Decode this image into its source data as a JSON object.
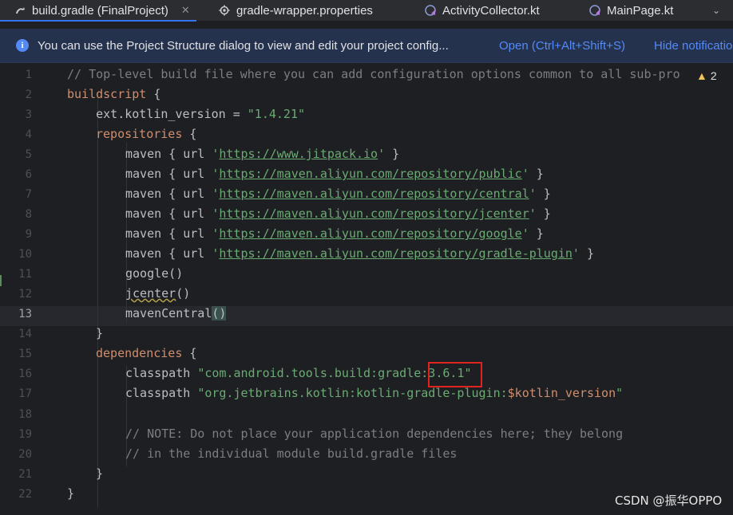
{
  "tabs": [
    {
      "label": "build.gradle (FinalProject)",
      "icon": "gradle-icon",
      "close": "✕",
      "active": true
    },
    {
      "label": "gradle-wrapper.properties",
      "icon": "gear-icon"
    },
    {
      "label": "ActivityCollector.kt",
      "icon": "kotlin-class-icon"
    },
    {
      "label": "MainPage.kt",
      "icon": "kotlin-class-icon"
    }
  ],
  "tab_more": "⌄",
  "banner": {
    "icon": "i",
    "message": "You can use the Project Structure dialog to view and edit your project config...",
    "open_link": "Open (Ctrl+Alt+Shift+S)",
    "hide_link": "Hide notification"
  },
  "editor": {
    "warning_icon": "▲",
    "warning_count": "2",
    "current_line": 13,
    "line_numbers": [
      "1",
      "2",
      "3",
      "4",
      "5",
      "6",
      "7",
      "8",
      "9",
      "10",
      "11",
      "12",
      "13",
      "14",
      "15",
      "16",
      "17",
      "18",
      "19",
      "20",
      "21",
      "22"
    ],
    "code": {
      "l1": "// Top-level build file where you can add configuration options common to all sub-pro",
      "l2_kw": "buildscript",
      "l2_rest": " {",
      "l3_a": "    ext.kotlin_version = ",
      "l3_str": "\"1.4.21\"",
      "l4_kw": "repositories",
      "l4_rest": " {",
      "maven_prefix": "maven { url ",
      "q": "'",
      "maven_suffix": " }",
      "urls": [
        "https://www.jitpack.io",
        "https://maven.aliyun.com/repository/public",
        "https://maven.aliyun.com/repository/central",
        "https://maven.aliyun.com/repository/jcenter",
        "https://maven.aliyun.com/repository/google",
        "https://maven.aliyun.com/repository/gradle-plugin"
      ],
      "l11": "google()",
      "l12": "jcenter",
      "l12_parens": "()",
      "l13_a": "mavenCentral",
      "l13_b": "(",
      "l13_c": ")",
      "l14": "}",
      "l15_kw": "dependencies",
      "l15_rest": " {",
      "l16_a": "classpath ",
      "l16_str": "\"com.android.tools.build:gradle:",
      "l16_ver": "3.6.1\"",
      "l17_a": "classpath ",
      "l17_str": "\"org.jetbrains.kotlin:kotlin-gradle-plugin:",
      "l17_var": "$kotlin_version",
      "l17_end": "\"",
      "l19": "// NOTE: Do not place your application dependencies here; they belong",
      "l20": "// in the individual module build.gradle files",
      "l21": "}",
      "l22": "}"
    }
  },
  "watermark": "CSDN @振华OPPO"
}
